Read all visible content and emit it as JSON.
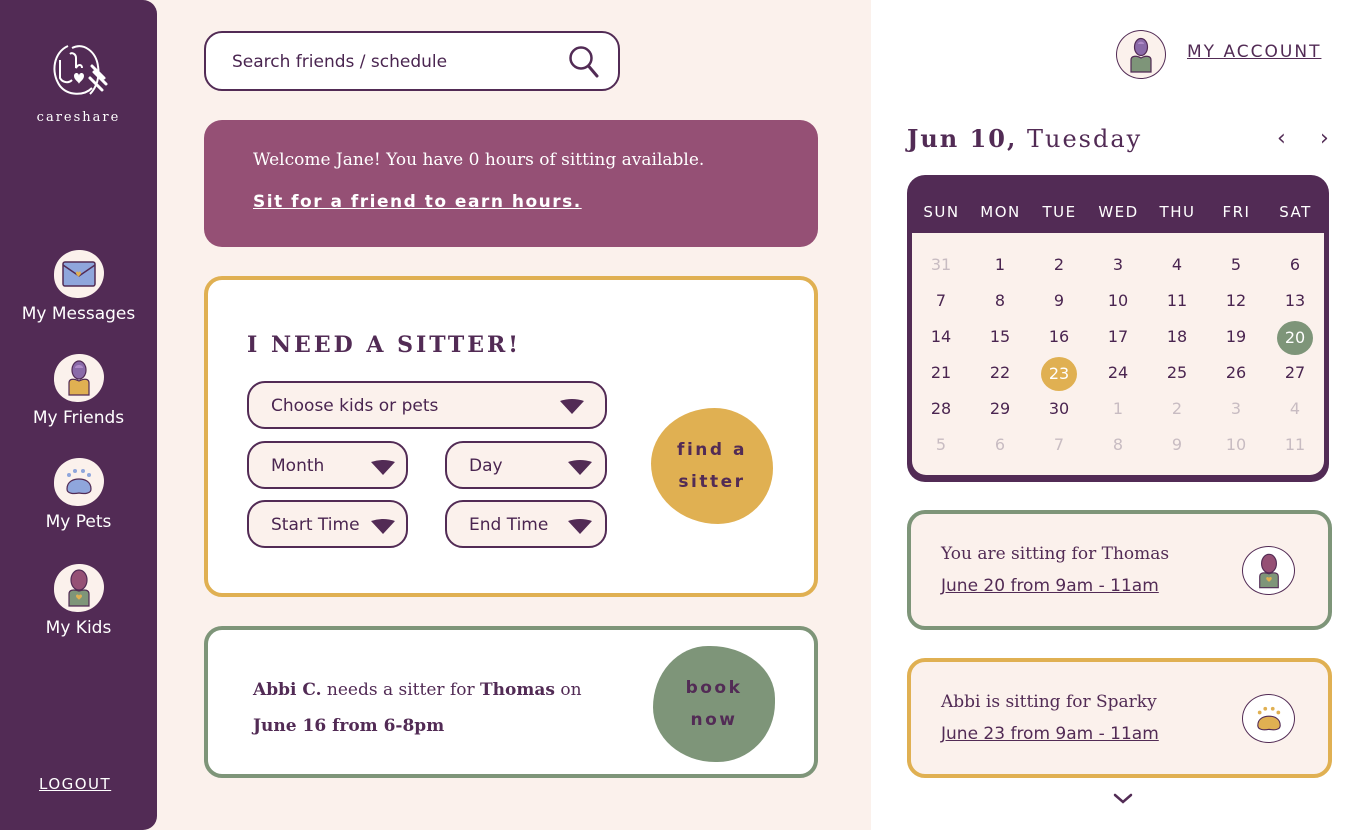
{
  "app": {
    "logo_text": "careshare"
  },
  "colors": {
    "plum": "#522b55",
    "mauve": "#955075",
    "gold": "#e0b052",
    "sage": "#7e9579",
    "cream": "#fbf1ec"
  },
  "sidebar": {
    "items": [
      {
        "label": "My Messages",
        "icon": "envelope-icon"
      },
      {
        "label": "My Friends",
        "icon": "friend-avatar-icon"
      },
      {
        "label": "My Pets",
        "icon": "paw-icon"
      },
      {
        "label": "My Kids",
        "icon": "kid-avatar-icon"
      }
    ],
    "logout_label": "LOGOUT"
  },
  "search": {
    "placeholder": "Search friends / schedule"
  },
  "welcome": {
    "text": "Welcome Jane! You have 0 hours of sitting available.",
    "link": "Sit for a friend to earn hours."
  },
  "sitter_form": {
    "title": "I NEED A SITTER!",
    "kids_select": "Choose kids or pets",
    "month_select": "Month",
    "day_select": "Day",
    "start_select": "Start Time",
    "end_select": "End Time",
    "button_line1": "find a",
    "button_line2": "sitter"
  },
  "request": {
    "name": "Abbi C.",
    "mid": " needs a sitter for ",
    "child": "Thomas",
    "on": " on",
    "when": "June 16 from 6-8pm",
    "button_line1": "book",
    "button_line2": "now"
  },
  "header": {
    "account_label": "MY ACCOUNT"
  },
  "calendar": {
    "date_bold": "Jun 10,",
    "date_rest": " Tuesday",
    "prev": "‹",
    "next": "›",
    "weekdays": [
      "SUN",
      "MON",
      "TUE",
      "WED",
      "THU",
      "FRI",
      "SAT"
    ],
    "weeks": [
      [
        "31",
        "1",
        "2",
        "3",
        "4",
        "5",
        "6"
      ],
      [
        "7",
        "8",
        "9",
        "10",
        "11",
        "12",
        "13"
      ],
      [
        "14",
        "15",
        "16",
        "17",
        "18",
        "19",
        "20"
      ],
      [
        "21",
        "22",
        "23",
        "24",
        "25",
        "26",
        "27"
      ],
      [
        "28",
        "29",
        "30",
        "1",
        "2",
        "3",
        "4"
      ],
      [
        "5",
        "6",
        "7",
        "8",
        "9",
        "10",
        "11"
      ]
    ],
    "selected_day": "23",
    "booked_day": "20"
  },
  "appointments": [
    {
      "title": "You are sitting for Thomas",
      "time": "June 20 from 9am - 11am",
      "color": "#7e9579",
      "icon": "kid-avatar-icon"
    },
    {
      "title": "Abbi is sitting for Sparky",
      "time": "June 23 from 9am - 11am",
      "color": "#e0b052",
      "icon": "paw-icon"
    }
  ]
}
